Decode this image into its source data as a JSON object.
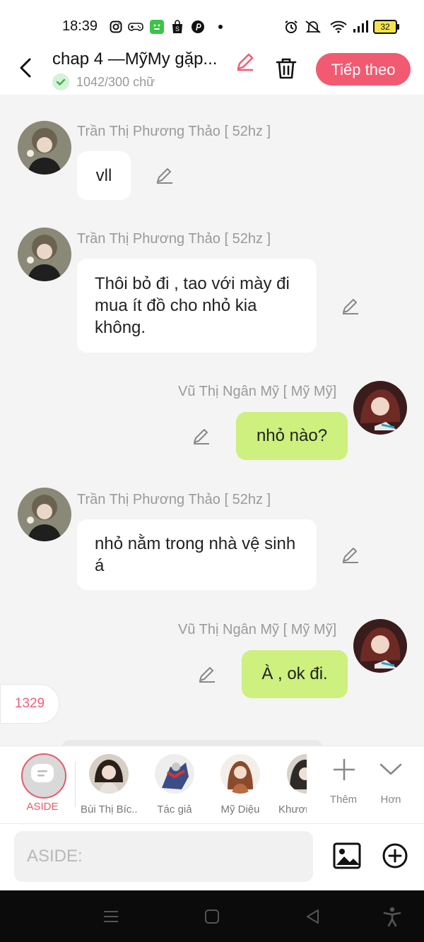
{
  "status_bar": {
    "time": "18:39",
    "battery": "32",
    "icons": [
      "instagram-icon",
      "gamepad-icon",
      "wechat-icon",
      "shop-icon",
      "pinterest-icon",
      "dot-icon",
      "alarm-icon",
      "mute-icon",
      "wifi-icon",
      "signal-icon",
      "battery-icon"
    ]
  },
  "header": {
    "title": "chap 4 —MỹMy gặp...",
    "word_count": "1042/300 chữ",
    "next_label": "Tiếp theo",
    "accent": "#f25a72"
  },
  "messages": [
    {
      "side": "left",
      "author": "Trần Thị Phương Thảo [ 52hz ]",
      "text": "vll"
    },
    {
      "side": "left",
      "author": "Trần Thị Phương Thảo [ 52hz ]",
      "text": "Thôi bỏ đi , tao với mày đi mua ít đồ cho nhỏ kia không."
    },
    {
      "side": "right",
      "author": "Vũ Thị Ngân Mỹ [ Mỹ Mỹ]",
      "text": "nhỏ nào?"
    },
    {
      "side": "left",
      "author": "Trần Thị Phương Thảo [ 52hz ]",
      "text": "nhỏ nằm trong nhà vệ sinh á"
    },
    {
      "side": "right",
      "author": "Vũ Thị Ngân Mỹ [ Mỹ Mỹ]",
      "text": "À , ok đi."
    }
  ],
  "count_pill": "1329",
  "character_bar": {
    "aside_label": "ASIDE",
    "characters": [
      "Bùi Thị Bíc...",
      "Tác giả",
      "Mỹ Diệu",
      "Khươn"
    ],
    "more_label": "Thêm",
    "expand_label": "Hơn"
  },
  "composer": {
    "placeholder": "ASIDE:"
  },
  "colors": {
    "left_bubble": "#ffffff",
    "right_bubble": "#cdf07e",
    "background": "#f4f4f4"
  }
}
